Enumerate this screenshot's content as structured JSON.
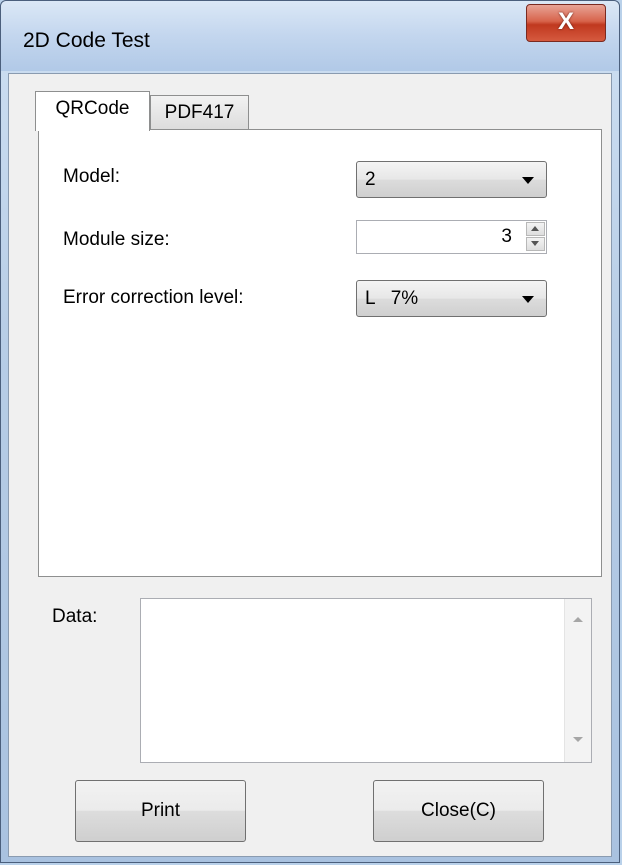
{
  "window": {
    "title": "2D Code Test",
    "close_glyph": "X"
  },
  "tabs": [
    {
      "label": "QRCode",
      "active": true
    },
    {
      "label": "PDF417",
      "active": false
    }
  ],
  "qrcode": {
    "model_label": "Model:",
    "model_value": "2",
    "module_size_label": "Module size:",
    "module_size_value": "3",
    "ecl_label": "Error correction level:",
    "ecl_value": "L   7%"
  },
  "data_label": "Data:",
  "data_value": "",
  "buttons": {
    "print": "Print",
    "close": "Close(C)"
  },
  "icons": [
    "close-icon",
    "dropdown-arrow-icon",
    "spin-up-icon",
    "spin-down-icon",
    "scroll-up-icon",
    "scroll-down-icon"
  ]
}
